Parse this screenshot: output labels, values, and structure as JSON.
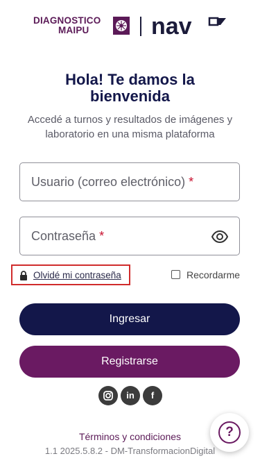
{
  "header": {
    "brand_line1": "DIAGNOSTICO",
    "brand_line2": "MAIPU",
    "nav_logo": "nav"
  },
  "welcome": {
    "title_line1": "Hola! Te damos la",
    "title_line2": "bienvenida",
    "subtitle": "Accedé a turnos y resultados de imágenes y laboratorio en una misma plataforma"
  },
  "form": {
    "username_label": "Usuario (correo electrónico)",
    "password_label": "Contraseña",
    "required_mark": "*",
    "forgot_password": "Olvidé mi contraseña",
    "remember_me": "Recordarme",
    "remember_checked": false
  },
  "buttons": {
    "login": "Ingresar",
    "register": "Registrarse"
  },
  "social": {
    "items": [
      "instagram-icon",
      "linkedin-icon",
      "facebook-icon"
    ],
    "linkedin_glyph": "in",
    "facebook_glyph": "f"
  },
  "footer": {
    "terms": "Términos y condiciones",
    "version": "1.1 2025.5.8.2 - DM-TransformacionDigital"
  },
  "help": {
    "glyph": "?"
  },
  "colors": {
    "primary_navy": "#13174a",
    "brand_purple": "#6a1a62",
    "highlight_red": "#d02b2b",
    "required_red": "#c8102e"
  }
}
